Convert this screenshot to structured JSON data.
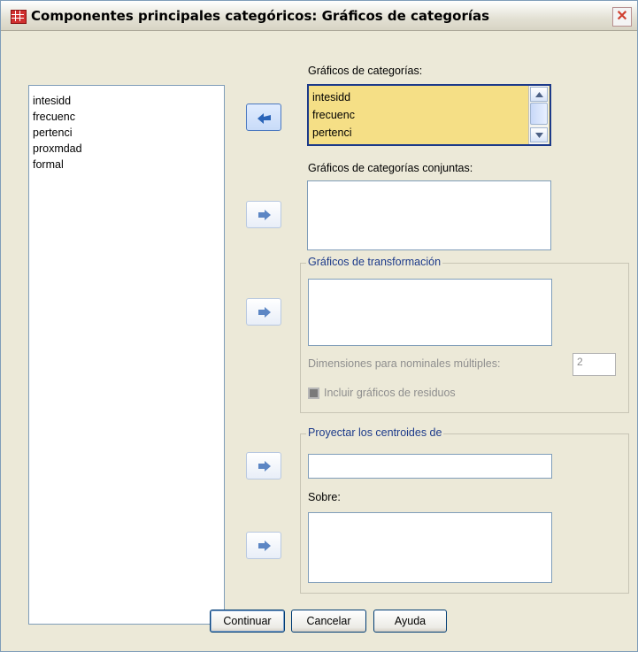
{
  "window": {
    "title": "Componentes principales categóricos: Gráficos de categorías",
    "close_glyph": "✕"
  },
  "source_list": {
    "items": [
      "intesidd",
      "frecuenc",
      "pertenci",
      "proxmdad",
      "formal"
    ]
  },
  "category_plots": {
    "label": "Gráficos de categorías:",
    "items": [
      "intesidd",
      "frecuenc",
      "pertenci"
    ],
    "highlight_color": "#f5df86"
  },
  "joint_plots": {
    "label": "Gráficos de categorías conjuntas:"
  },
  "transformation_plots": {
    "legend": "Gráficos de transformación",
    "dimensions_label": "Dimensiones para nominales múltiples:",
    "dimensions_value": "2",
    "residuals_label": "Incluir gráficos de residuos",
    "residuals_checked": false
  },
  "project_centroids": {
    "legend": "Proyectar los centroides de",
    "onto_label": "Sobre:"
  },
  "buttons": {
    "continue": "Continuar",
    "cancel": "Cancelar",
    "help": "Ayuda"
  },
  "icons": {
    "app": "spss-dialog-icon",
    "move_left": "arrow-left-icon",
    "move_right": "arrow-right-icon"
  }
}
